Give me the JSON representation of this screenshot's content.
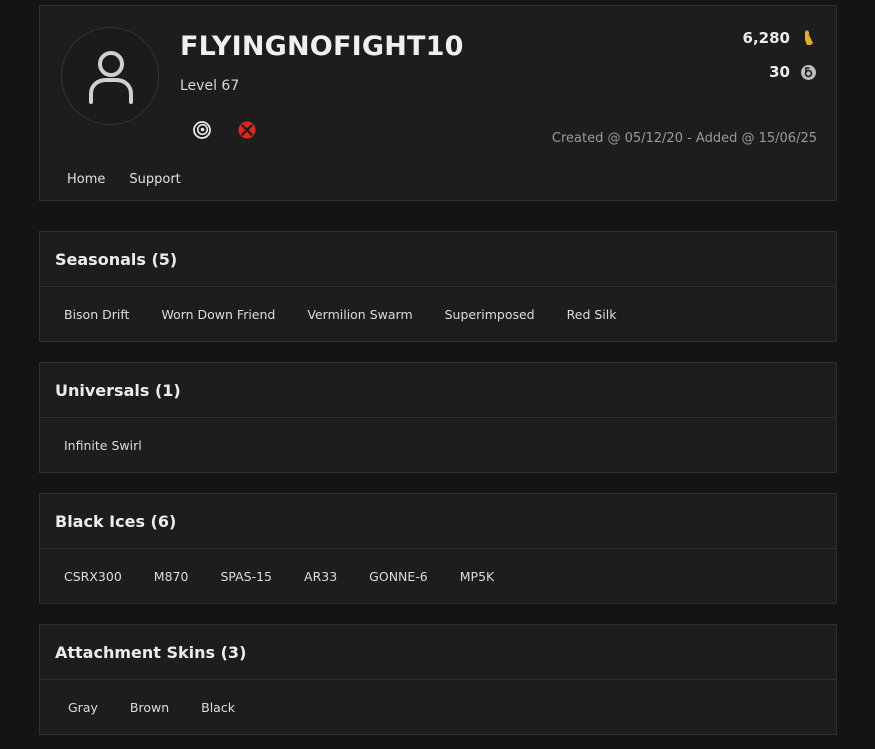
{
  "profile": {
    "username": "FLYINGNOFIGHT10",
    "level": "Level 67",
    "credits": "6,280",
    "renown": "30",
    "created": "Created @ 05/12/20 - Added @ 15/06/25",
    "platforms": [
      "ubisoft-icon",
      "xbox-icon"
    ],
    "colors": {
      "xbox": "#e8251b",
      "credits_icon": "#e0b021"
    }
  },
  "nav": {
    "home": "Home",
    "support": "Support"
  },
  "sections": [
    {
      "title": "Seasonals (5)",
      "items": [
        "Bison Drift",
        "Worn Down Friend",
        "Vermilion Swarm",
        "Superimposed",
        "Red Silk"
      ]
    },
    {
      "title": "Universals (1)",
      "items": [
        "Infinite Swirl"
      ]
    },
    {
      "title": "Black Ices (6)",
      "items": [
        "CSRX300",
        "M870",
        "SPAS-15",
        "AR33",
        "GONNE-6",
        "MP5K"
      ]
    },
    {
      "title": "Attachment Skins (3)",
      "items": [
        "Gray",
        "Brown",
        "Black"
      ]
    }
  ]
}
